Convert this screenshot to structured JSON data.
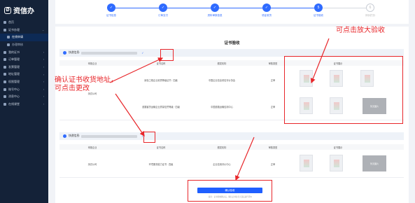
{
  "app": {
    "logo_text": "资信办",
    "logo_mark": "Ø"
  },
  "sidebar": {
    "items": [
      {
        "label": "首页",
        "icon": "home-icon"
      },
      {
        "label": "证书办理",
        "icon": "certificate-icon",
        "arrow": "⌄"
      },
      {
        "label": "在线申请",
        "icon": "apply-icon",
        "sub": true
      },
      {
        "label": "办理审核",
        "icon": "review-icon",
        "sub": true
      },
      {
        "label": "我的证书",
        "icon": "my-cert-icon",
        "arrow": "›"
      },
      {
        "label": "订单管理",
        "icon": "order-icon",
        "arrow": "›"
      },
      {
        "label": "发票管理",
        "icon": "invoice-icon",
        "arrow": "›"
      },
      {
        "label": "地址管理",
        "icon": "address-icon",
        "arrow": "›"
      },
      {
        "label": "权限管理",
        "icon": "permission-icon",
        "arrow": "›"
      },
      {
        "label": "账号中心",
        "icon": "account-icon",
        "arrow": "›"
      },
      {
        "label": "消息中心",
        "icon": "message-icon",
        "arrow": "›"
      },
      {
        "label": "在线课堂",
        "icon": "class-icon",
        "arrow": "›"
      }
    ]
  },
  "steps": [
    {
      "label": "证书信息",
      "num": "✓"
    },
    {
      "label": "订单支付",
      "num": "✓"
    },
    {
      "label": "资料审核信息",
      "num": "✓"
    },
    {
      "label": "领证收货",
      "num": "✓"
    },
    {
      "label": "证书验收",
      "num": "5"
    },
    {
      "label": "评价打分",
      "num": "6"
    }
  ],
  "main": {
    "title": "证书验收",
    "group1": {
      "address_label": "快递信息:",
      "edit_icon": "✓",
      "headers": [
        "申报企业",
        "证书名称",
        "颁发机构",
        "审核类型",
        "证书展示"
      ],
      "company": "测试公司",
      "rows": [
        {
          "cert": "绿色工程企业资质等级证书 · 四级",
          "issuer": "中国企业信息资信评价协会",
          "type": "正审"
        },
        {
          "cert": "道路客货运输企业质量信誉等级 · 四级",
          "issuer": "中国道路运输信用中心",
          "type": "正审"
        }
      ],
      "gray_thumb_label": "暂无图片"
    },
    "group2": {
      "address_label": "快递信息:",
      "edit_icon": "✓",
      "headers": [
        "申报企业",
        "证书名称",
        "颁发机构",
        "审核类型",
        "证书展示"
      ],
      "rows": [
        {
          "company": "测试公司",
          "cert": "环境服务能力证书 · 四级",
          "issuer": "企业信用评价中心",
          "type": "正审"
        }
      ],
      "gray_thumb_label": "暂无图片"
    },
    "confirm_button": "确认验收",
    "confirm_tip": "提示：证书验收确认后，确认证书信息无误后进行评价"
  },
  "annotations": {
    "top_right": "可点击放大验收",
    "left": "确认证书收货地址，\n可点击更改"
  },
  "colors": {
    "accent": "#2f6bff",
    "sidebar": "#142238",
    "annotation": "#e8262a"
  }
}
